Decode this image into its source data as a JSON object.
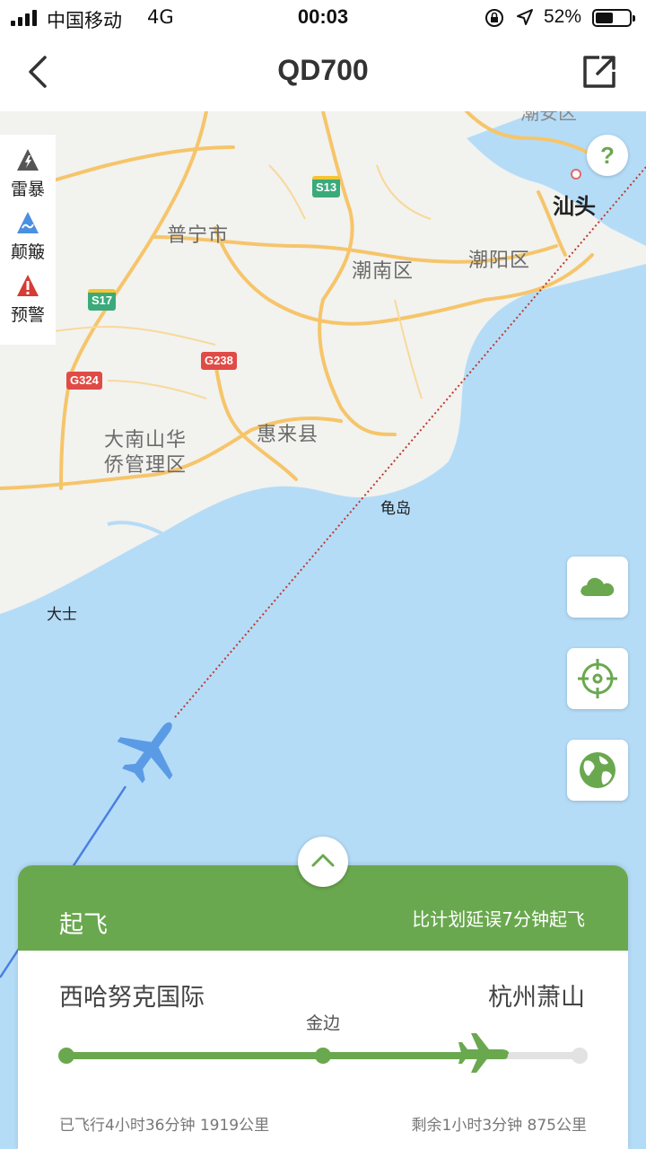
{
  "status_bar": {
    "carrier": "中国移动",
    "network": "4G",
    "time": "00:03",
    "battery_percent": "52%",
    "battery_level": 0.52
  },
  "nav": {
    "title": "QD700",
    "back_icon": "chevron-left-icon",
    "share_icon": "share-external-icon"
  },
  "map": {
    "labels": {
      "puning": "普宁市",
      "chaonan": "潮南区",
      "chaoyang": "潮阳区",
      "shantou": "汕头",
      "huilai": "惠来县",
      "danan_1": "大南山华",
      "danan_2": "侨管理区",
      "guidao": "龟岛",
      "dashi": "大士",
      "top_partial": "潮安区"
    },
    "shields": {
      "s13": "S13",
      "s17": "S17",
      "g238": "G238",
      "g324": "G324"
    },
    "colors": {
      "land": "#f2f2ef",
      "sea": "#b5dcf7",
      "road": "#f6c56a",
      "flight_path_flown": "#4a7fe0",
      "flight_path_planned": "#c0392b",
      "plane": "#5b9be6"
    }
  },
  "legend": {
    "items": [
      {
        "label": "雷暴",
        "icon": "lightning-icon",
        "color": "#555555"
      },
      {
        "label": "颠簸",
        "icon": "turbulence-icon",
        "color": "#4a8fe0"
      },
      {
        "label": "预警",
        "icon": "warning-icon",
        "color": "#d63b34"
      }
    ]
  },
  "help_button": {
    "label": "?"
  },
  "side_buttons": [
    {
      "name": "weather",
      "icon": "cloud-icon"
    },
    {
      "name": "locate",
      "icon": "crosshair-icon"
    },
    {
      "name": "globe",
      "icon": "globe-icon"
    }
  ],
  "card": {
    "status": "起飞",
    "delay_text": "比计划延误7分钟起飞",
    "departure": "西哈努克国际",
    "arrival": "杭州萧山",
    "via": "金边",
    "progress": 0.86,
    "flown_text": "已飞行4小时36分钟 1919公里",
    "remaining_text": "剩余1小时3分钟 875公里",
    "accent": "#6aa84f"
  }
}
